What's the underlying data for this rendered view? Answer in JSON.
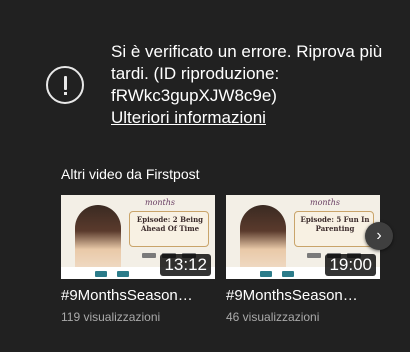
{
  "error": {
    "message": "Si è verificato un errore. Riprova più tardi. (ID riproduzione: fRWkc3gupXJW8c9e)",
    "link_text": "Ulteriori informazioni"
  },
  "more_videos": {
    "title": "Altri video da Firstpost",
    "items": [
      {
        "thumb_brand": "months",
        "thumb_episode": "Episode: 2 Being Ahead Of Time",
        "duration": "13:12",
        "title": "#9MonthsSeason…",
        "views": "119 visualizzazioni"
      },
      {
        "thumb_brand": "months",
        "thumb_episode": "Episode: 5 Fun In Parenting",
        "duration": "19:00",
        "title": "#9MonthsSeason…",
        "views": "46 visualizzazioni"
      }
    ],
    "next_icon": "chevron-right-icon"
  }
}
